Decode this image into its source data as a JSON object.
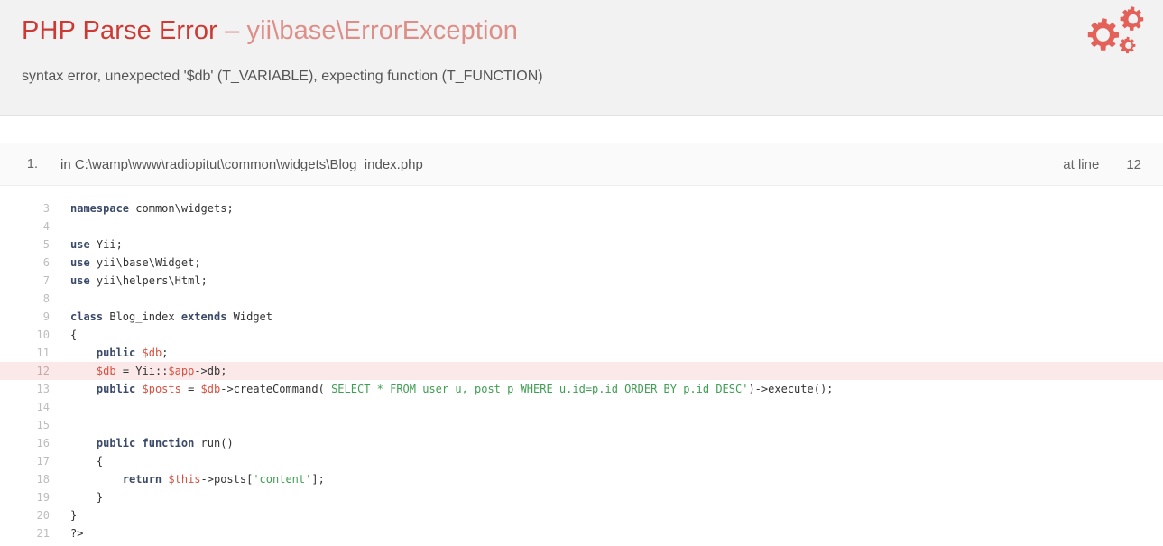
{
  "header": {
    "error_type": "PHP Parse Error",
    "separator": "–",
    "exception_class": "yii\\base\\ErrorException",
    "message": "syntax error, unexpected '$db' (T_VARIABLE), expecting function (T_FUNCTION)",
    "icon": "gears-icon",
    "colors": {
      "background": "#f2f2f2",
      "error_type": "#cc3a33",
      "exception_class": "#dd8e88",
      "message": "#555555",
      "icon": "#e4615a"
    }
  },
  "callstack": {
    "items": [
      {
        "number": "1.",
        "file": "in C:\\wamp\\www\\radiopitut\\common\\widgets\\Blog_index.php",
        "at_line_label": "at line",
        "line_number": "12"
      }
    ]
  },
  "code": {
    "error_line": 12,
    "highlight_color": "#fbe9e9",
    "lines": [
      {
        "n": "3",
        "text": "namespace common\\widgets;"
      },
      {
        "n": "4",
        "text": ""
      },
      {
        "n": "5",
        "text": "use Yii;"
      },
      {
        "n": "6",
        "text": "use yii\\base\\Widget;"
      },
      {
        "n": "7",
        "text": "use yii\\helpers\\Html;"
      },
      {
        "n": "8",
        "text": ""
      },
      {
        "n": "9",
        "text": "class Blog_index extends Widget"
      },
      {
        "n": "10",
        "text": "{"
      },
      {
        "n": "11",
        "text": "    public $db;"
      },
      {
        "n": "12",
        "text": "    $db = Yii::$app->db;"
      },
      {
        "n": "13",
        "text": "    public $posts = $db->createCommand('SELECT * FROM user u, post p WHERE u.id=p.id ORDER BY p.id DESC')->execute();"
      },
      {
        "n": "14",
        "text": ""
      },
      {
        "n": "15",
        "text": ""
      },
      {
        "n": "16",
        "text": "    public function run()"
      },
      {
        "n": "17",
        "text": "    {"
      },
      {
        "n": "18",
        "text": "        return $this->posts['content'];"
      },
      {
        "n": "19",
        "text": "    }"
      },
      {
        "n": "20",
        "text": "}"
      },
      {
        "n": "21",
        "text": "?>"
      }
    ]
  }
}
